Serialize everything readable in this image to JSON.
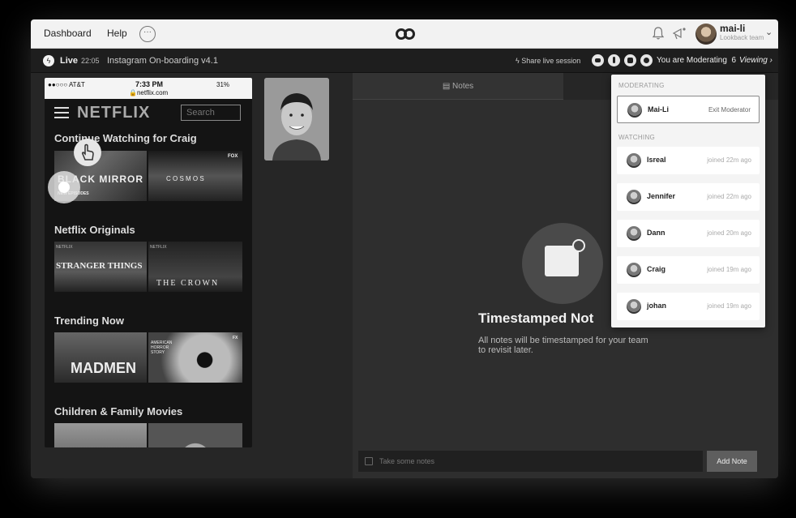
{
  "topbar": {
    "nav_dashboard": "Dashboard",
    "nav_help": "Help",
    "more_glyph": "···",
    "user_name": "mai-li",
    "user_team": "Lookback team"
  },
  "session": {
    "live_label": "Live",
    "time": "22:05",
    "title": "Instagram On-boarding v4.1",
    "share_label": "Share live session",
    "moderating_label": "You are Moderating",
    "viewer_count": "6",
    "viewing_label": "Viewing"
  },
  "phone": {
    "carrier": "●●○○○ AT&T",
    "time": "7:33 PM",
    "url": "netflix.com",
    "battery": "31%",
    "logo": "NETFLIX",
    "search": "Search",
    "rows": [
      {
        "title": "Continue Watching for Craig"
      },
      {
        "title": "Netflix Originals"
      },
      {
        "title": "Trending Now"
      },
      {
        "title": "Children & Family Movies"
      }
    ],
    "tiles": {
      "black_mirror": "BLACK MIRROR",
      "new_episodes": "NEW EPISODES",
      "cosmos": "C O S M O S",
      "fox": "FOX",
      "netflix_small": "NETFLIX",
      "stranger_things": "STRANGER THINGS",
      "the_crown": "THE CROWN",
      "mad_men": "MADMEN",
      "american_horror": "AMERICAN HORROR STORY",
      "fx": "FX"
    }
  },
  "notes": {
    "tab_label": "Notes",
    "heading": "Timestamped Not",
    "subtext": "All notes will be timestamped for your team to revisit later.",
    "input_placeholder": "Take some notes",
    "add_button": "Add Note"
  },
  "viewers": {
    "moderating_header": "MODERATING",
    "watching_header": "WATCHING",
    "moderator": {
      "name": "Mai-Li",
      "action": "Exit Moderator"
    },
    "watching": [
      {
        "name": "Isreal",
        "joined": "joined 22m ago"
      },
      {
        "name": "Jennifer",
        "joined": "joined 22m ago"
      },
      {
        "name": "Dann",
        "joined": "joined 20m ago"
      },
      {
        "name": "Craig",
        "joined": "joined 19m ago"
      },
      {
        "name": "johan",
        "joined": "joined 19m ago"
      }
    ]
  },
  "icons": [
    "lookback-logo-icon",
    "bell-icon",
    "megaphone-icon",
    "lightning-icon",
    "video-icon",
    "mic-icon",
    "stop-icon",
    "viewers-icon",
    "document-icon",
    "clock-icon",
    "hand-pointer-icon"
  ]
}
